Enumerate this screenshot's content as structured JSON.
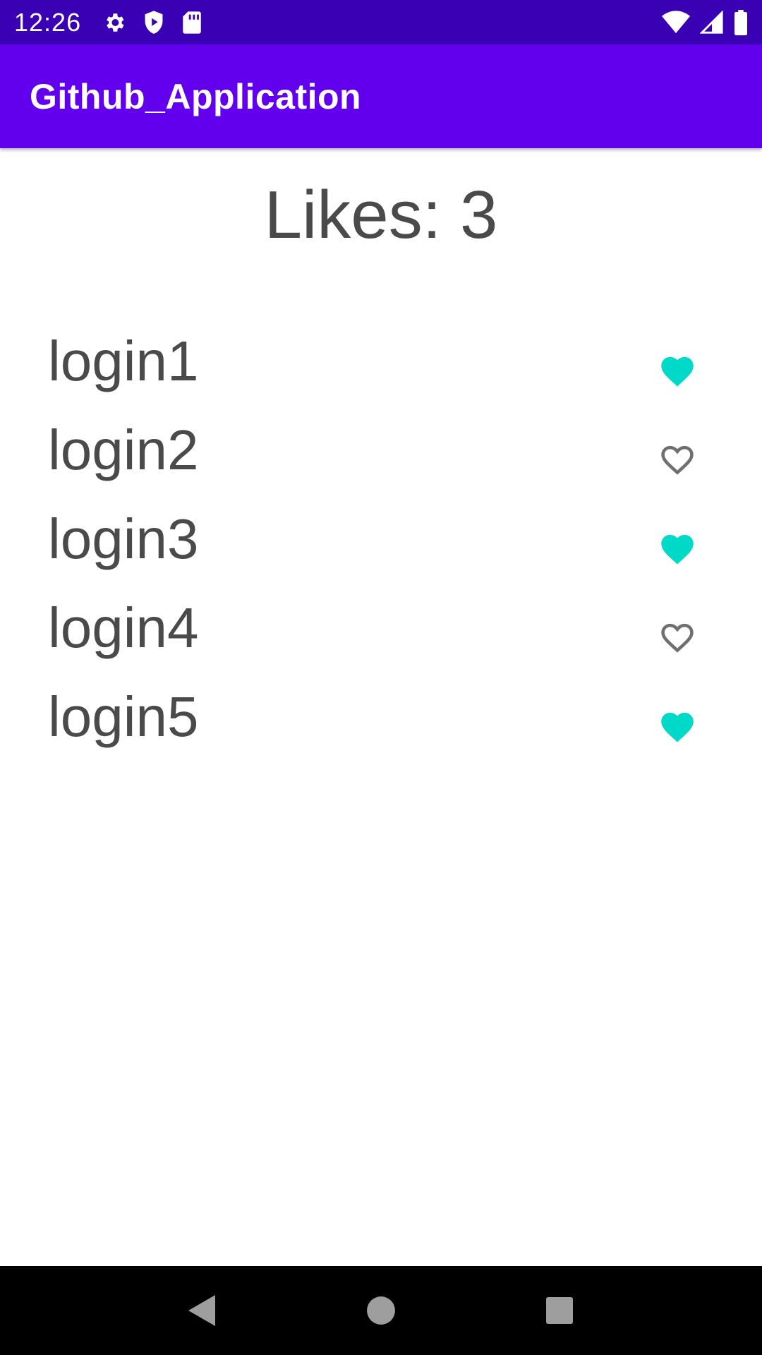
{
  "status_bar": {
    "time": "12:26",
    "left_icons": [
      "gear-icon",
      "shield-play-icon",
      "sd-card-icon"
    ],
    "right_icons": [
      "wifi-icon",
      "cell-signal-icon",
      "battery-icon"
    ]
  },
  "app_bar": {
    "title": "Github_Application",
    "color": "#6200ee"
  },
  "likes": {
    "label": "Likes: 3"
  },
  "users": [
    {
      "login": "login1",
      "liked": true
    },
    {
      "login": "login2",
      "liked": false
    },
    {
      "login": "login3",
      "liked": true
    },
    {
      "login": "login4",
      "liked": false
    },
    {
      "login": "login5",
      "liked": true
    }
  ],
  "colors": {
    "liked": "#00d8c8",
    "unliked_outline": "#6f6f6f",
    "status_bar": "#3a00b3"
  },
  "nav_bar": {
    "buttons": [
      "back-icon",
      "home-icon",
      "recents-icon"
    ]
  }
}
